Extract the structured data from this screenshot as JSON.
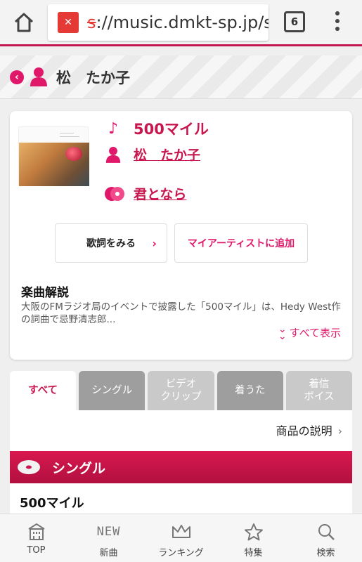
{
  "browser": {
    "url_scheme": "s",
    "url_host": "://music.dmkt-sp.jp/s",
    "tab_count": "6"
  },
  "artist_header": {
    "name": "松　たか子"
  },
  "song": {
    "title": "500マイル",
    "artist": "松　たか子",
    "album": "君となら",
    "lyrics_button": "歌詞をみる",
    "add_artist_button": "マイアーティストに追加",
    "description_title": "楽曲解説",
    "description_text": "大阪のFMラジオ局のイベントで披露した「500マイル」は、Hedy West作の詞曲で忌野清志郎...",
    "show_all": "すべて表示"
  },
  "tabs": [
    {
      "label": "すべて"
    },
    {
      "label": "シングル"
    },
    {
      "label": "ビデオ\nクリップ"
    },
    {
      "label": "着うた"
    },
    {
      "label": "着信\nボイス"
    }
  ],
  "products": {
    "description_link": "商品の説明",
    "section_title": "シングル",
    "first_item": "500マイル"
  },
  "bottom_nav": [
    {
      "label": "TOP",
      "icon": "building-icon"
    },
    {
      "label": "新曲",
      "icon_text": "NEW"
    },
    {
      "label": "ランキング",
      "icon": "crown-icon"
    },
    {
      "label": "特集",
      "icon": "star-icon"
    },
    {
      "label": "検索",
      "icon": "search-icon"
    }
  ],
  "colors": {
    "accent": "#c8174f",
    "pink": "#e0186a"
  }
}
